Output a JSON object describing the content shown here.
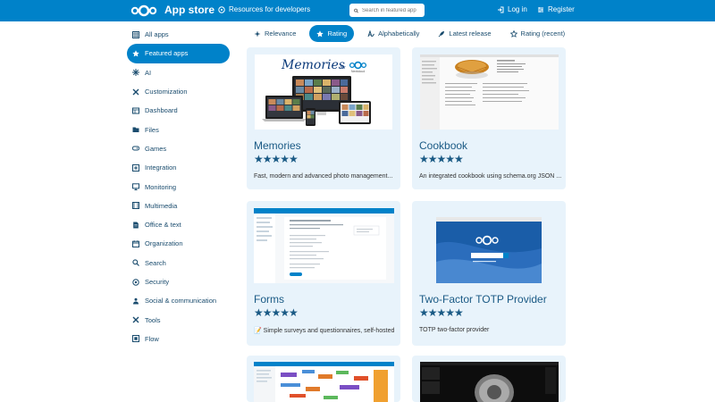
{
  "header": {
    "title": "App store",
    "resources_label": "Resources for developers",
    "search_placeholder": "Search in featured app",
    "login_label": "Log in",
    "register_label": "Register"
  },
  "sidebar": {
    "items": [
      {
        "label": "All apps",
        "icon": "grid-icon"
      },
      {
        "label": "Featured apps",
        "icon": "star-icon"
      },
      {
        "label": "AI",
        "icon": "ai-icon"
      },
      {
        "label": "Customization",
        "icon": "tools-icon"
      },
      {
        "label": "Dashboard",
        "icon": "dashboard-icon"
      },
      {
        "label": "Files",
        "icon": "folder-icon"
      },
      {
        "label": "Games",
        "icon": "gamepad-icon"
      },
      {
        "label": "Integration",
        "icon": "integration-icon"
      },
      {
        "label": "Monitoring",
        "icon": "monitor-icon"
      },
      {
        "label": "Multimedia",
        "icon": "film-icon"
      },
      {
        "label": "Office & text",
        "icon": "document-icon"
      },
      {
        "label": "Organization",
        "icon": "calendar-icon"
      },
      {
        "label": "Search",
        "icon": "search-icon"
      },
      {
        "label": "Security",
        "icon": "security-icon"
      },
      {
        "label": "Social & communication",
        "icon": "people-icon"
      },
      {
        "label": "Tools",
        "icon": "wrench-icon"
      },
      {
        "label": "Flow",
        "icon": "flow-icon"
      }
    ]
  },
  "sort": {
    "tabs": [
      {
        "label": "Relevance"
      },
      {
        "label": "Rating"
      },
      {
        "label": "Alphabetically"
      },
      {
        "label": "Latest release"
      },
      {
        "label": "Rating (recent)"
      }
    ]
  },
  "apps": [
    {
      "name": "Memories",
      "stars": "★★★★★",
      "description": "Fast, modern and advanced photo management...",
      "shot_title": "Memories",
      "shot_logo_text": "Nextcloud"
    },
    {
      "name": "Cookbook",
      "stars": "★★★★★",
      "description": "An integrated cookbook using schema.org JSON ..."
    },
    {
      "name": "Forms",
      "stars": "★★★★★",
      "description": "📝 Simple surveys and questionnaires, self-hosted"
    },
    {
      "name": "Two-Factor TOTP Provider",
      "stars": "★★★★★",
      "description": "TOTP two-factor provider"
    }
  ],
  "colors": {
    "accent": "#0082c9",
    "card_bg": "#e8f3fb",
    "title": "#1a5a85"
  }
}
